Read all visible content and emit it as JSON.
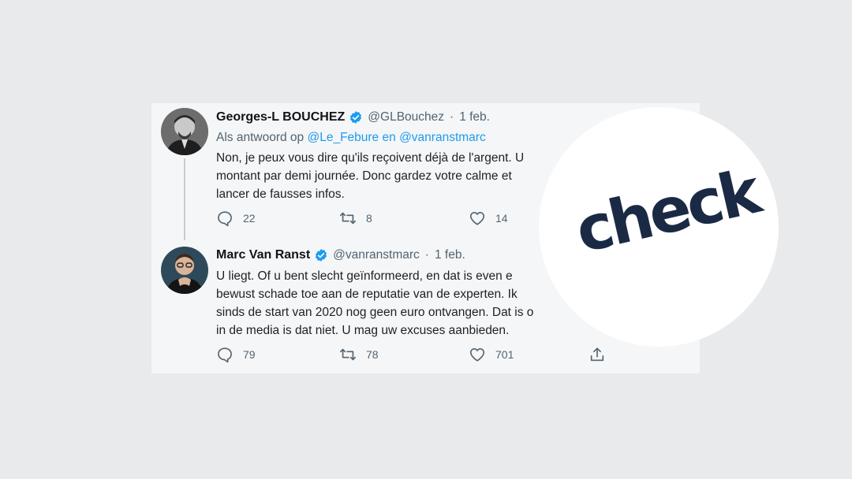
{
  "tweets": [
    {
      "name": "Georges-L BOUCHEZ",
      "handle": "@GLBouchez",
      "separator": "·",
      "date": "1 feb.",
      "reply_to": {
        "prefix": "Als antwoord op",
        "mention1": "@Le_Febure",
        "conjunction": "en",
        "mention2": "@vanranstmarc"
      },
      "body_lines": [
        "Non, je peux vous dire qu'ils reçoivent déjà de l'argent. U",
        "montant par demi journée. Donc gardez votre calme et",
        "lancer de fausses infos."
      ],
      "actions": {
        "replies": "22",
        "retweets": "8",
        "likes": "14"
      }
    },
    {
      "name": "Marc Van Ranst",
      "handle": "@vanranstmarc",
      "separator": "·",
      "date": "1 feb.",
      "body_lines": [
        "U liegt. Of u bent slecht geïnformeerd, en dat is even e",
        "bewust schade toe aan de reputatie van de experten. Ik",
        "sinds de start van 2020 nog geen euro ontvangen. Dat is o",
        "in de media is dat niet. U mag uw excuses aanbieden."
      ],
      "actions": {
        "replies": "79",
        "retweets": "78",
        "likes": "701"
      }
    }
  ],
  "overlay": {
    "label": "check",
    "text_color": "#1b2a44",
    "circle_color": "#ffffff"
  },
  "icons": {
    "verified": "verified-badge-icon",
    "reply": "speech-bubble-icon",
    "retweet": "retweet-arrows-icon",
    "like": "heart-icon",
    "share": "share-upload-icon"
  },
  "colors": {
    "background": "#e9eaec",
    "card": "#f5f6f7",
    "link": "#1d9bf0",
    "verified": "#1d9bf0",
    "text": "#1b2127",
    "muted": "#536471"
  }
}
